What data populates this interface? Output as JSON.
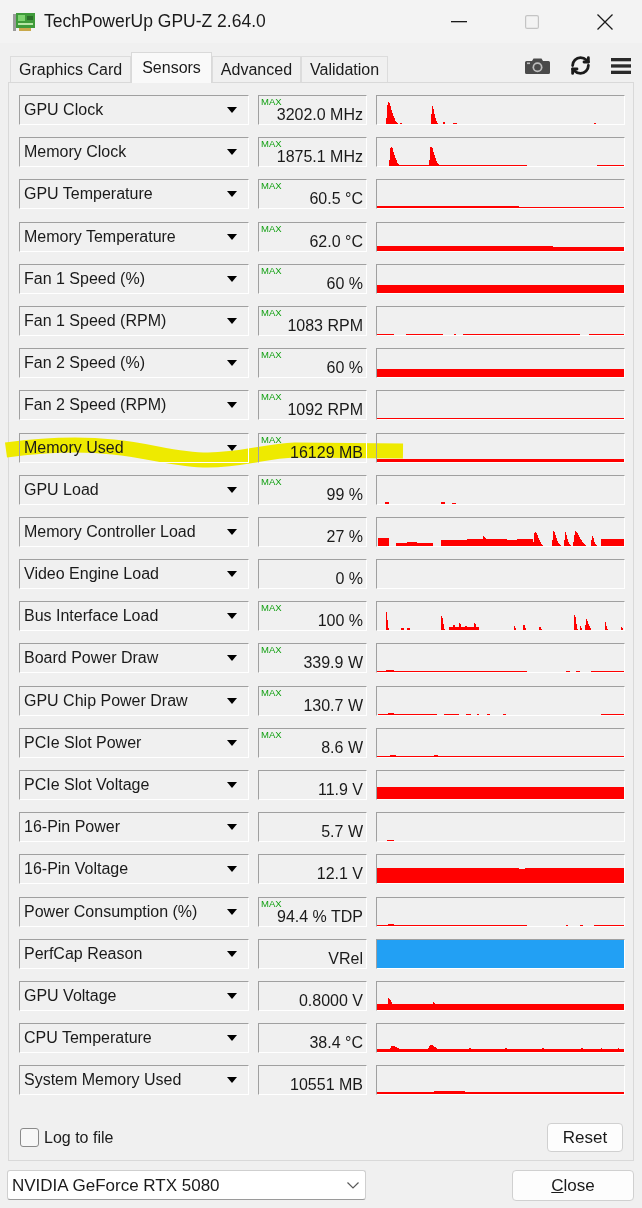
{
  "window": {
    "title": "TechPowerUp GPU-Z 2.64.0",
    "maximize": {
      "disabled": true
    }
  },
  "tabs": [
    {
      "label": "Graphics Card",
      "selected": false
    },
    {
      "label": "Sensors",
      "selected": true
    },
    {
      "label": "Advanced",
      "selected": false
    },
    {
      "label": "Validation",
      "selected": false
    }
  ],
  "sensors": [
    {
      "name": "GPU Clock",
      "mode": "MAX",
      "value": "3202.0 MHz",
      "color": "#ff0000",
      "highlighted": false
    },
    {
      "name": "Memory Clock",
      "mode": "MAX",
      "value": "1875.1 MHz",
      "color": "#ff0000",
      "highlighted": false
    },
    {
      "name": "GPU Temperature",
      "mode": "MAX",
      "value": "60.5 °C",
      "color": "#ff0000",
      "highlighted": false
    },
    {
      "name": "Memory Temperature",
      "mode": "MAX",
      "value": "62.0 °C",
      "color": "#ff0000",
      "highlighted": false
    },
    {
      "name": "Fan 1 Speed (%)",
      "mode": "MAX",
      "value": "60 %",
      "color": "#ff0000",
      "highlighted": false
    },
    {
      "name": "Fan 1 Speed (RPM)",
      "mode": "MAX",
      "value": "1083 RPM",
      "color": "#ff0000",
      "highlighted": false
    },
    {
      "name": "Fan 2 Speed (%)",
      "mode": "MAX",
      "value": "60 %",
      "color": "#ff0000",
      "highlighted": false
    },
    {
      "name": "Fan 2 Speed (RPM)",
      "mode": "MAX",
      "value": "1092 RPM",
      "color": "#ff0000",
      "highlighted": false
    },
    {
      "name": "Memory Used",
      "mode": "MAX",
      "value": "16129 MB",
      "color": "#ff0000",
      "highlighted": true
    },
    {
      "name": "GPU Load",
      "mode": "MAX",
      "value": "99 %",
      "color": "#ff0000",
      "highlighted": false
    },
    {
      "name": "Memory Controller Load",
      "value": "27 %",
      "color": "#ff0000",
      "highlighted": false
    },
    {
      "name": "Video Engine Load",
      "value": "0 %",
      "highlighted": false
    },
    {
      "name": "Bus Interface Load",
      "mode": "MAX",
      "value": "100 %",
      "color": "#ff0000",
      "highlighted": false
    },
    {
      "name": "Board Power Draw",
      "mode": "MAX",
      "value": "339.9 W",
      "color": "#ff0000",
      "highlighted": false
    },
    {
      "name": "GPU Chip Power Draw",
      "mode": "MAX",
      "value": "130.7 W",
      "color": "#ff0000",
      "highlighted": false
    },
    {
      "name": "PCIe Slot Power",
      "mode": "MAX",
      "value": "8.6 W",
      "color": "#ff0000",
      "highlighted": false
    },
    {
      "name": "PCIe Slot Voltage",
      "value": "11.9 V",
      "color": "#ff0000",
      "highlighted": false
    },
    {
      "name": "16-Pin Power",
      "value": "5.7 W",
      "color": "#ff0000",
      "highlighted": false
    },
    {
      "name": "16-Pin Voltage",
      "value": "12.1 V",
      "color": "#ff0000",
      "highlighted": false
    },
    {
      "name": "Power Consumption (%)",
      "mode": "MAX",
      "value": "94.4 % TDP",
      "color": "#ff0000",
      "highlighted": false
    },
    {
      "name": "PerfCap Reason",
      "value": "VRel",
      "color": "#22a0f4",
      "highlighted": false
    },
    {
      "name": "GPU Voltage",
      "value": "0.8000 V",
      "color": "#ff0000",
      "highlighted": false
    },
    {
      "name": "CPU Temperature",
      "value": "38.4 °C",
      "color": "#ff0000",
      "highlighted": false
    },
    {
      "name": "System Memory Used",
      "value": "10551 MB",
      "color": "#ff0000",
      "highlighted": false
    }
  ],
  "log_to_file": {
    "label": "Log to file",
    "checked": false
  },
  "reset_button": {
    "label": "Reset"
  },
  "device_select": {
    "value": "NVIDIA GeForce RTX 5080"
  },
  "close_button": {
    "label": "Close",
    "access_key_underlined": true
  }
}
